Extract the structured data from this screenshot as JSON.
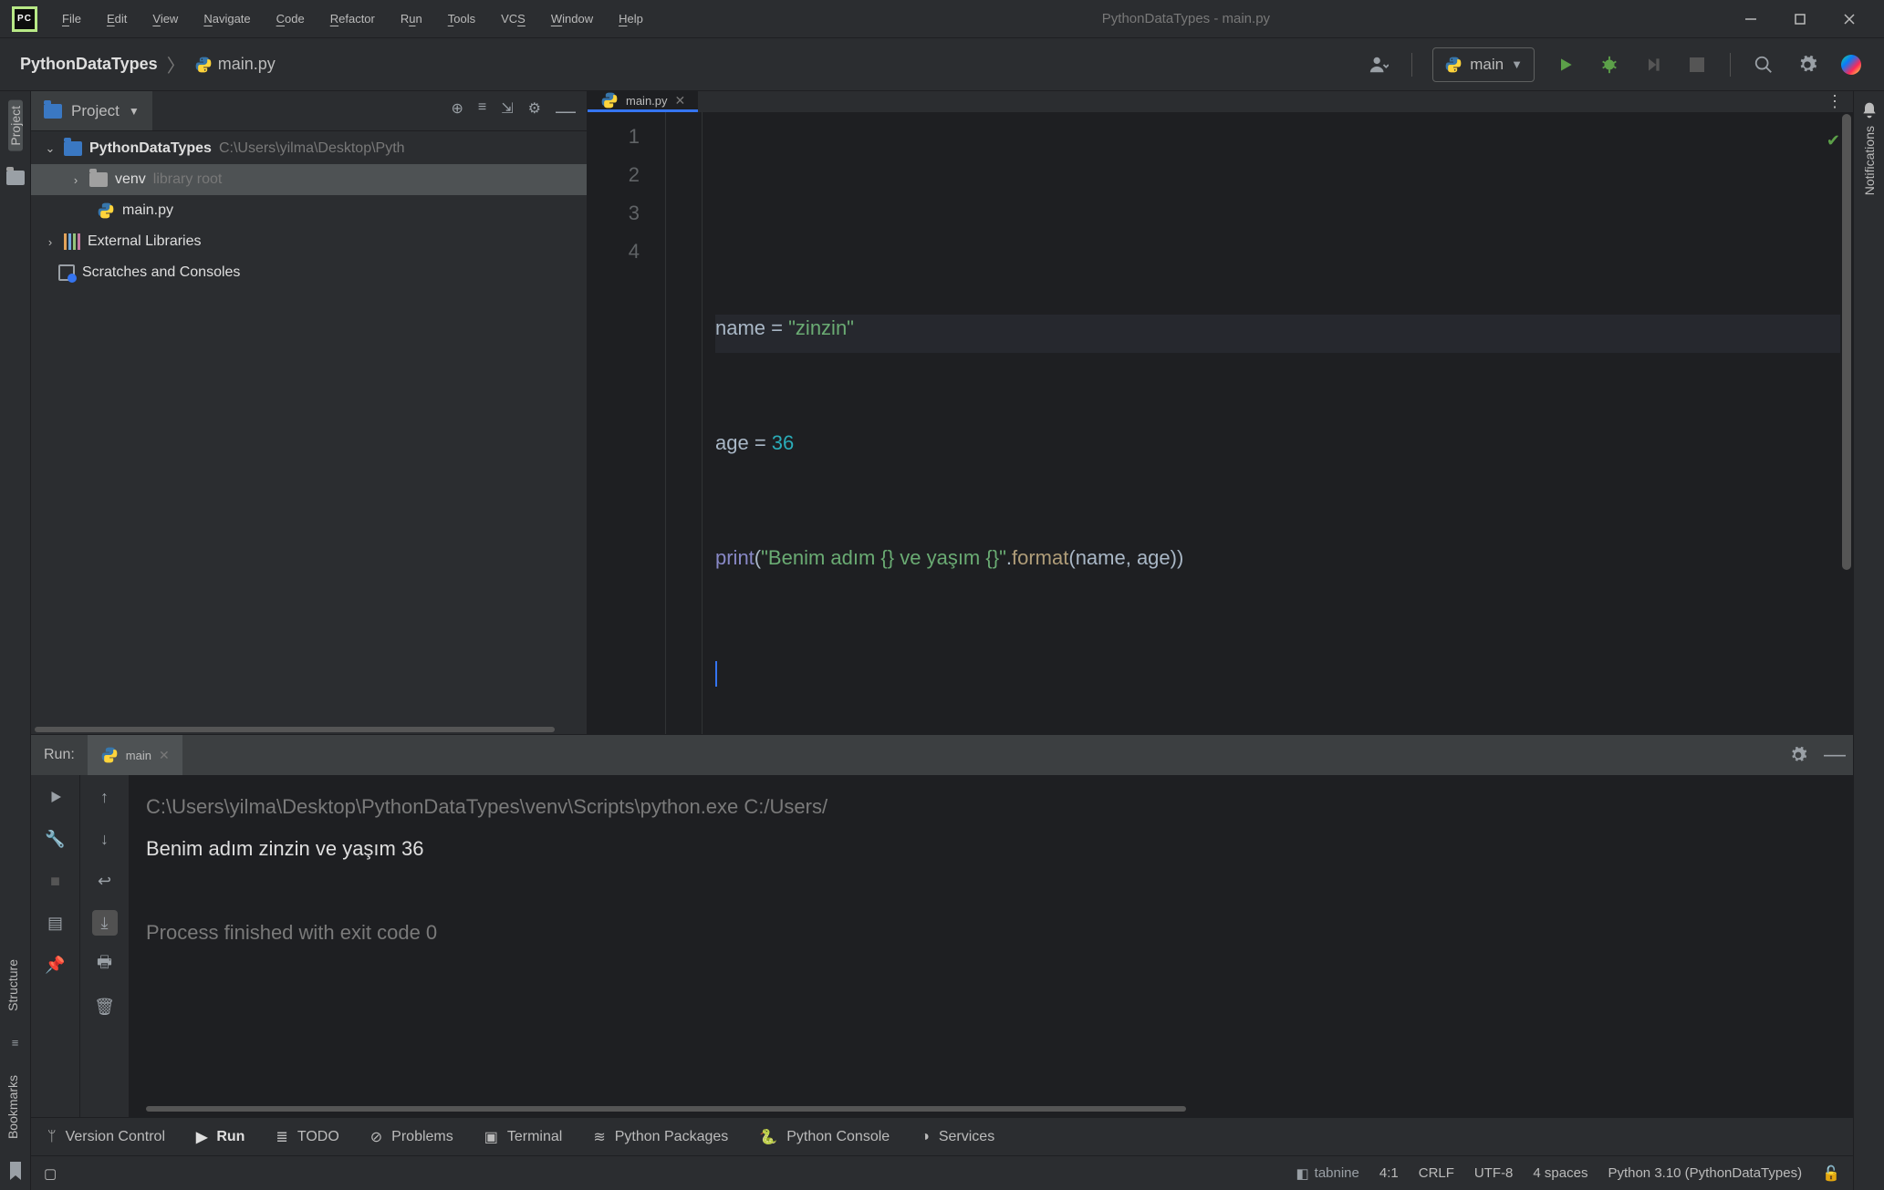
{
  "window_title": "PythonDataTypes - main.py",
  "menu": [
    "File",
    "Edit",
    "View",
    "Navigate",
    "Code",
    "Refactor",
    "Run",
    "Tools",
    "VCS",
    "Window",
    "Help"
  ],
  "breadcrumb": {
    "project": "PythonDataTypes",
    "file": "main.py"
  },
  "run_config_name": "main",
  "project_pane": {
    "title": "Project",
    "root_name": "PythonDataTypes",
    "root_path": "C:\\Users\\yilma\\Desktop\\Pyth",
    "venv": "venv",
    "venv_hint": "library root",
    "file": "main.py",
    "external": "External Libraries",
    "scratches": "Scratches and Consoles"
  },
  "editor": {
    "tab": "main.py",
    "lines": [
      "1",
      "2",
      "3",
      "4"
    ],
    "code": {
      "l1": {
        "a": "name ",
        "op": "= ",
        "str": "\"zinzin\""
      },
      "l2": {
        "a": "age ",
        "op": "= ",
        "num": "36"
      },
      "l3": {
        "fn": "print",
        "p1": "(",
        "str": "\"Benim adım {} ve yaşım {}\"",
        "dot": ".",
        "m": "format",
        "p2": "(",
        "args": "name, age",
        "p3": "))"
      }
    }
  },
  "run": {
    "label": "Run:",
    "tab": "main",
    "cmd": "C:\\Users\\yilma\\Desktop\\PythonDataTypes\\venv\\Scripts\\python.exe C:/Users/",
    "out": "Benim adım zinzin ve yaşım 36",
    "exit": "Process finished with exit code 0"
  },
  "left_labels": {
    "project": "Project",
    "structure": "Structure",
    "bookmarks": "Bookmarks"
  },
  "right_labels": {
    "notifications": "Notifications"
  },
  "bottom_tools": {
    "vcs": "Version Control",
    "run": "Run",
    "todo": "TODO",
    "problems": "Problems",
    "terminal": "Terminal",
    "pkg": "Python Packages",
    "console": "Python Console",
    "services": "Services"
  },
  "status": {
    "tabnine": "tabnine",
    "pos": "4:1",
    "eol": "CRLF",
    "enc": "UTF-8",
    "indent": "4 spaces",
    "interp": "Python 3.10 (PythonDataTypes)"
  }
}
